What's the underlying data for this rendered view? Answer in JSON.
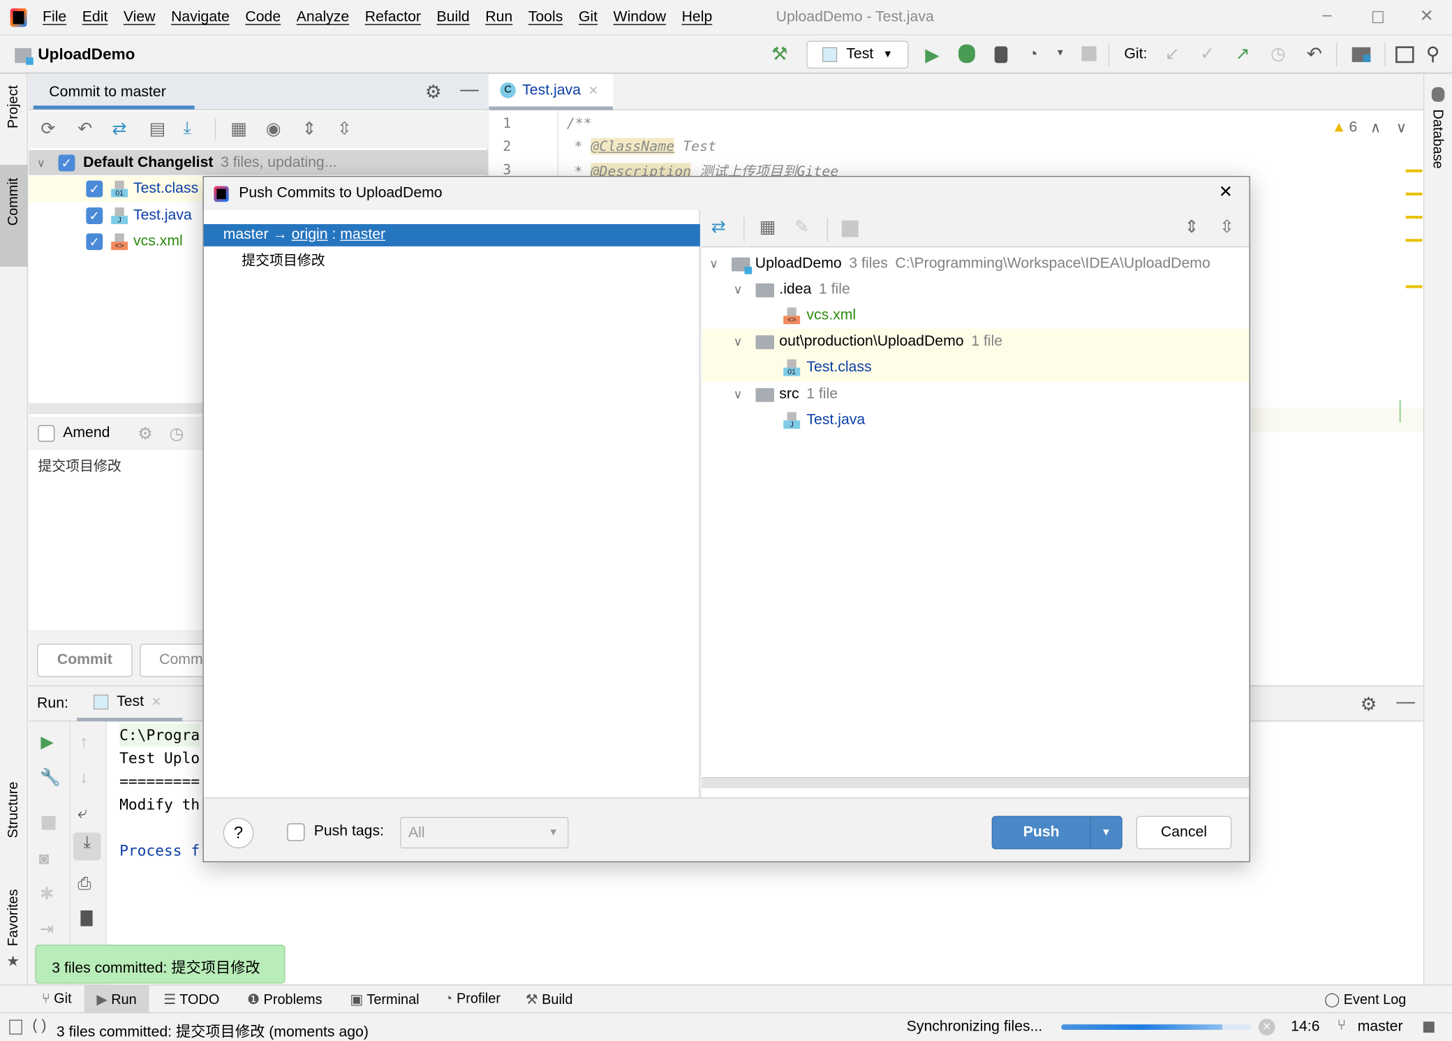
{
  "window": {
    "title": "UploadDemo - Test.java",
    "menu": [
      "File",
      "Edit",
      "View",
      "Navigate",
      "Code",
      "Analyze",
      "Refactor",
      "Build",
      "Run",
      "Tools",
      "Git",
      "Window",
      "Help"
    ]
  },
  "navbar": {
    "project": "UploadDemo",
    "run_config": "Test",
    "git_label": "Git:"
  },
  "side_tools": {
    "left": [
      "Project",
      "Commit",
      "Structure",
      "Favorites"
    ],
    "right": [
      "Database"
    ]
  },
  "commit_panel": {
    "title": "Commit to master",
    "changelist": "Default Changelist",
    "changelist_info": "3 files, updating...",
    "files": [
      {
        "name": "Test.class",
        "color": "#0b3ea6"
      },
      {
        "name": "Test.java",
        "color": "#0b3ea6"
      },
      {
        "name": "vcs.xml",
        "color": "#2b8a0e"
      }
    ],
    "amend": "Amend",
    "message": "提交项目修改",
    "commit_button": "Commit",
    "commit_push_button": "Comm"
  },
  "editor": {
    "tab": "Test.java",
    "lines": [
      {
        "n": "1",
        "text": "/**"
      },
      {
        "n": "2",
        "tag": "@ClassName",
        "rest": "Test"
      },
      {
        "n": "3",
        "tag": "@Description",
        "rest": "测试上传项目到Gitee"
      }
    ],
    "warnings": "6"
  },
  "run_panel": {
    "label": "Run:",
    "tab": "Test",
    "output": [
      "C:\\Progra",
      "Test Uplo",
      "=========",
      "Modify th",
      "",
      "Process f"
    ]
  },
  "dialog": {
    "title": "Push Commits to UploadDemo",
    "branch_local": "master",
    "arrow": "→",
    "remote": "origin",
    "sep": ":",
    "branch_remote": "master",
    "commit": "提交项目修改",
    "tree": [
      {
        "name": "UploadDemo",
        "info": "3 files",
        "path": "C:\\Programming\\Workspace\\IDEA\\UploadDemo",
        "level": 0,
        "type": "module"
      },
      {
        "name": ".idea",
        "info": "1 file",
        "level": 1,
        "type": "folder"
      },
      {
        "name": "vcs.xml",
        "level": 2,
        "type": "xml",
        "color": "#2b8a0e"
      },
      {
        "name": "out\\production\\UploadDemo",
        "info": "1 file",
        "level": 1,
        "type": "folder",
        "highlight": true
      },
      {
        "name": "Test.class",
        "level": 2,
        "type": "class",
        "color": "#0b3ea6",
        "highlight": true
      },
      {
        "name": "src",
        "info": "1 file",
        "level": 1,
        "type": "folder"
      },
      {
        "name": "Test.java",
        "level": 2,
        "type": "java",
        "color": "#0b3ea6"
      }
    ],
    "help": "?",
    "push_tags": "Push tags:",
    "push_tags_value": "All",
    "push": "Push",
    "cancel": "Cancel"
  },
  "toast": "3 files committed: 提交项目修改",
  "bottom_tabs": [
    "Git",
    "Run",
    "TODO",
    "Problems",
    "Terminal",
    "Profiler",
    "Build"
  ],
  "event_log": "Event Log",
  "status": {
    "message": "3 files committed: 提交项目修改 (moments ago)",
    "sync": "Synchronizing files...",
    "progress": 0.85,
    "position": "14:6",
    "branch": "master"
  },
  "colors": {
    "accent": "#4a88c7",
    "selection": "#2675bf",
    "toast": "#b8ecb8",
    "highlight_row": "#fffde7"
  }
}
